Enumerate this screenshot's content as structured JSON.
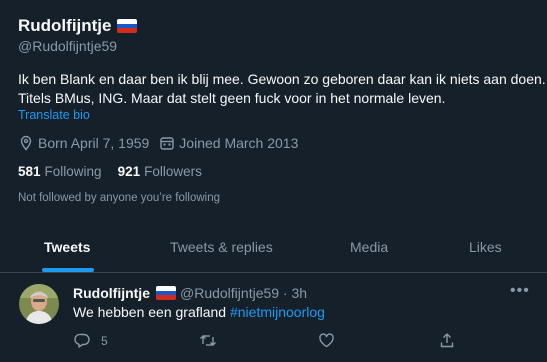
{
  "profile": {
    "name": "Rudolfijntje",
    "handle": "@Rudolfijntje59",
    "bio_line1": "Ik ben Blank en daar ben ik blij mee. Gewoon zo geboren daar kan ik niets aan doen.",
    "bio_line2": "Titels BMus, ING.  Maar dat stelt geen fuck voor in het normale leven.",
    "translate_label": "Translate bio",
    "born": "Born April 7, 1959",
    "joined": "Joined March 2013",
    "following_count": "581",
    "following_label": "Following",
    "followers_count": "921",
    "followers_label": "Followers",
    "not_followed": "Not followed by anyone you’re following"
  },
  "tabs": [
    "Tweets",
    "Tweets & replies",
    "Media",
    "Likes"
  ],
  "tweet": {
    "name": "Rudolfijntje",
    "handle_time": "@Rudolfijntje59 · 3h",
    "text": "We hebben een grafland ",
    "hashtag": "#nietmijnoorlog",
    "reply_count": "5"
  },
  "colors": {
    "background": "#15202b",
    "accent": "#1d9bf0",
    "muted": "#8b98a5"
  }
}
